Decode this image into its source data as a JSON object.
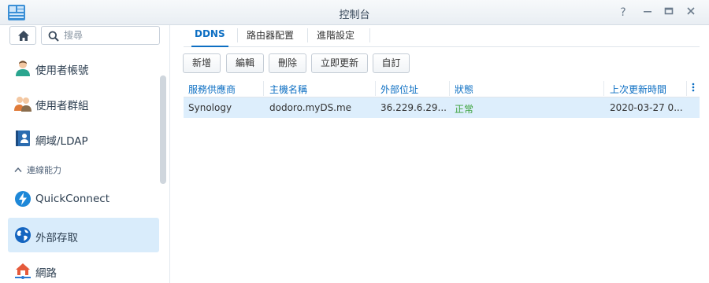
{
  "window": {
    "title": "控制台"
  },
  "sidebar": {
    "search_placeholder": "搜尋",
    "items": [
      {
        "label": "使用者帳號",
        "icon": "user-icon"
      },
      {
        "label": "使用者群組",
        "icon": "user-group-icon"
      },
      {
        "label": "網域/LDAP",
        "icon": "directory-icon"
      }
    ],
    "group": {
      "label": "連線能力",
      "icon": "chevron-up-icon"
    },
    "group_items": [
      {
        "label": "QuickConnect",
        "icon": "quickconnect-icon"
      },
      {
        "label": "外部存取",
        "icon": "globe-icon",
        "active": true
      },
      {
        "label": "網路",
        "icon": "network-icon"
      }
    ]
  },
  "tabs": [
    "DDNS",
    "路由器配置",
    "進階設定"
  ],
  "toolbar": {
    "add": "新增",
    "edit": "編輯",
    "delete": "刪除",
    "update_now": "立即更新",
    "customize": "自訂"
  },
  "table": {
    "headers": [
      "服務供應商",
      "主機名稱",
      "外部位址",
      "狀態",
      "上次更新時間"
    ],
    "rows": [
      {
        "provider": "Synology",
        "hostname": "dodoro.myDS.me",
        "external_address": "36.229.6.29...",
        "status": "正常",
        "last_updated": "2020-03-27 0..."
      }
    ]
  },
  "colors": {
    "accent": "#0d6fc3",
    "status_ok": "#3aa13a",
    "selected_row": "#ddeefc",
    "active_nav": "#d9ecfb"
  }
}
